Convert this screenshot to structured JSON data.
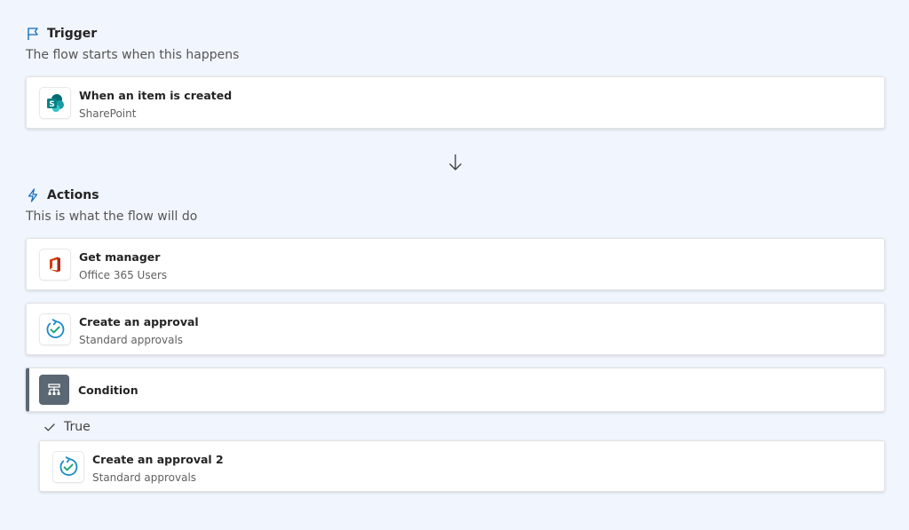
{
  "trigger": {
    "heading": "Trigger",
    "subtitle": "The flow starts when this happens",
    "card": {
      "title": "When an item is created",
      "connector": "SharePoint",
      "icon": "sharepoint-icon"
    }
  },
  "actions": {
    "heading": "Actions",
    "subtitle": "This is what the flow will do",
    "steps": [
      {
        "title": "Get manager",
        "connector": "Office 365 Users",
        "icon": "office-icon"
      },
      {
        "title": "Create an approval",
        "connector": "Standard approvals",
        "icon": "approval-icon"
      },
      {
        "title": "Condition",
        "icon": "condition-icon"
      }
    ],
    "branch": {
      "label": "True",
      "steps": [
        {
          "title": "Create an approval 2",
          "connector": "Standard approvals",
          "icon": "approval-icon"
        }
      ]
    }
  },
  "colors": {
    "background": "#f1f5fd",
    "accent": "#0f6cbd",
    "condition_tile": "#5b6773",
    "sharepoint": "#038387",
    "office": "#d83b01"
  }
}
